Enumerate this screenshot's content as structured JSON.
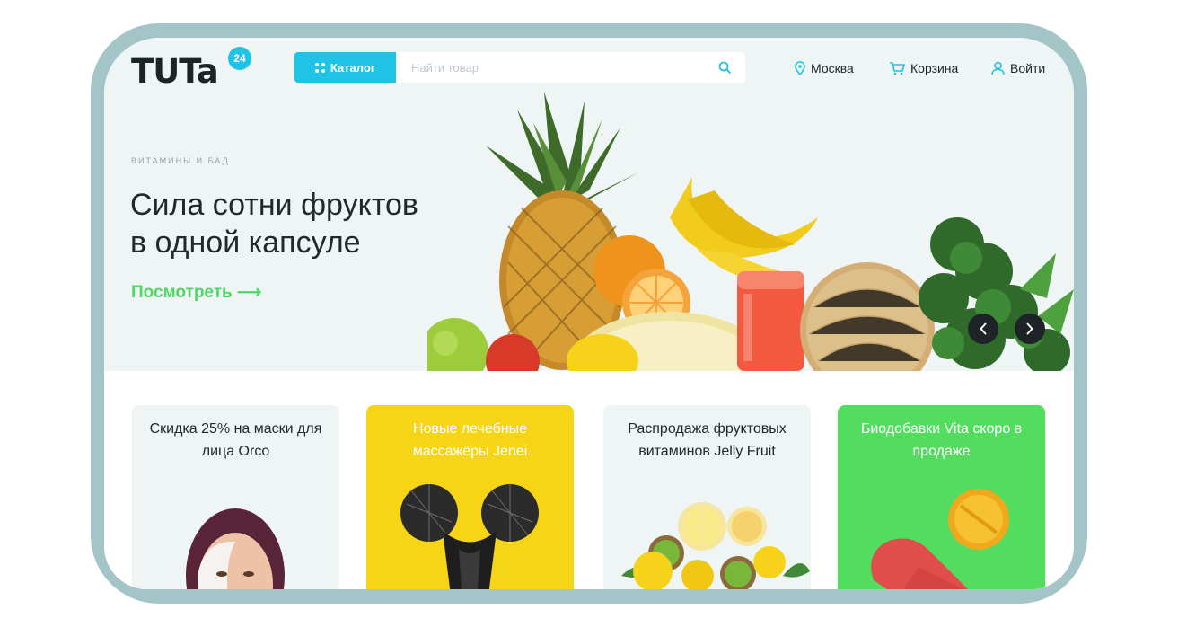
{
  "header": {
    "logo_text": "TUTa",
    "logo_badge": "24",
    "catalog_label": "Каталог",
    "search_placeholder": "Найти товар",
    "city_label": "Москва",
    "cart_label": "Корзина",
    "login_label": "Войти"
  },
  "hero": {
    "subtitle": "ВИТАМИНЫ И БАД",
    "title_line1": "Сила сотни фруктов",
    "title_line2": "в одной капсуле",
    "link_label": "Посмотреть ⟶"
  },
  "cards": [
    {
      "title": "Скидка 25% на маски для лица Orco",
      "bg": "#eef5f4",
      "text_color": "#23282d"
    },
    {
      "title": "Новые лечебные массажёры Jenei",
      "bg": "#f6d416",
      "text_color": "#ffffff"
    },
    {
      "title": "Распродажа фруктовых витаминов Jelly Fruit",
      "bg": "#eef5f4",
      "text_color": "#23282d"
    },
    {
      "title": "Биодобавки Vita скоро в продаже",
      "bg": "#52dd5e",
      "text_color": "#ffffff"
    }
  ],
  "colors": {
    "accent": "#1fc3e5",
    "green": "#4fd864",
    "frame": "#a4c5c7"
  },
  "icons": [
    "search-icon",
    "location-pin-icon",
    "cart-icon",
    "user-icon",
    "grid-icon",
    "chevron-left-icon",
    "chevron-right-icon"
  ]
}
